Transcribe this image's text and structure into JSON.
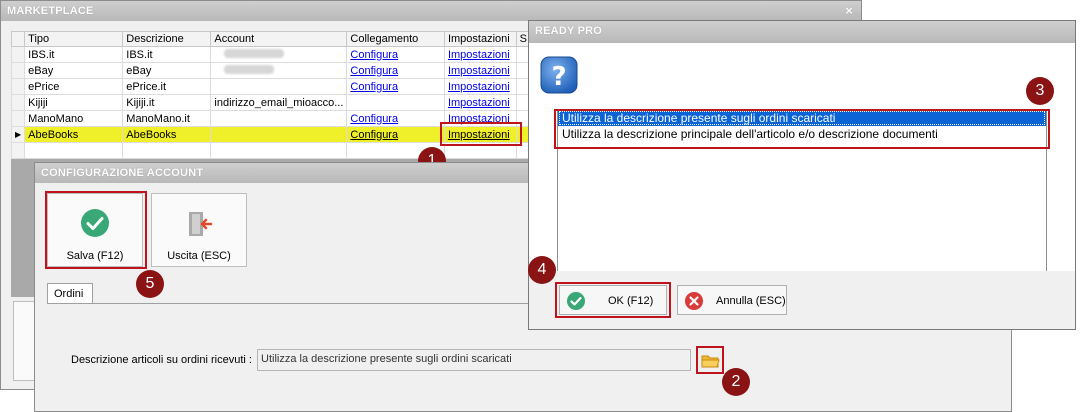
{
  "marketplace": {
    "title": "MARKETPLACE",
    "close_glyph": "×",
    "columns": [
      "Tipo",
      "Descrizione",
      "Account",
      "Collegamento",
      "Impostazioni",
      "S"
    ],
    "rows": [
      {
        "tipo": "IBS.it",
        "descrizione": "IBS.it",
        "account": "",
        "collegamento": "Configura",
        "impostazioni": "Impostazioni"
      },
      {
        "tipo": "eBay",
        "descrizione": "eBay",
        "account": "",
        "collegamento": "Configura",
        "impostazioni": "Impostazioni"
      },
      {
        "tipo": "ePrice",
        "descrizione": "ePrice.it",
        "account": "",
        "collegamento": "Configura",
        "impostazioni": "Impostazioni"
      },
      {
        "tipo": "Kijiji",
        "descrizione": "Kijiji.it",
        "account": "indirizzo_email_mioacco...",
        "collegamento": "",
        "impostazioni": "Impostazioni"
      },
      {
        "tipo": "ManoMano",
        "descrizione": "ManoMano.it",
        "account": "",
        "collegamento": "Configura",
        "impostazioni": "Impostazioni"
      },
      {
        "tipo": "AbeBooks",
        "descrizione": "AbeBooks",
        "account": "",
        "collegamento": "Configura",
        "impostazioni": "Impostazioni"
      }
    ],
    "selected_row_index": 5,
    "row_indicator_glyph": "▶"
  },
  "config_account": {
    "title": "CONFIGURAZIONE ACCOUNT",
    "save_label": "Salva (F12)",
    "exit_label": "Uscita (ESC)",
    "tab_label": "Ordini",
    "field_label": "Descrizione articoli  su ordini ricevuti :",
    "field_value": "Utilizza la descrizione presente sugli ordini scaricati"
  },
  "ready_pro": {
    "title": "READY PRO",
    "options": [
      "Utilizza la descrizione presente sugli ordini scaricati",
      "Utilizza la descrizione principale dell'articolo e/o descrizione documenti"
    ],
    "selected_option_index": 0,
    "ok_label": "OK (F12)",
    "cancel_label": "Annulla (ESC)"
  },
  "annotations": {
    "badges": [
      "1",
      "2",
      "3",
      "4",
      "5"
    ]
  },
  "colors": {
    "highlight_red": "#c0141c",
    "badge": "#8a1414",
    "selected_row": "#f0f02a",
    "list_selection": "#0a64d6",
    "save_green": "#3aa876",
    "cancel_red": "#d93a3a"
  },
  "icons": {
    "save": "check-circle-icon",
    "exit": "exit-door-icon",
    "folder": "folder-icon",
    "question": "question-icon",
    "ok": "check-circle-icon",
    "cancel": "x-circle-icon"
  }
}
